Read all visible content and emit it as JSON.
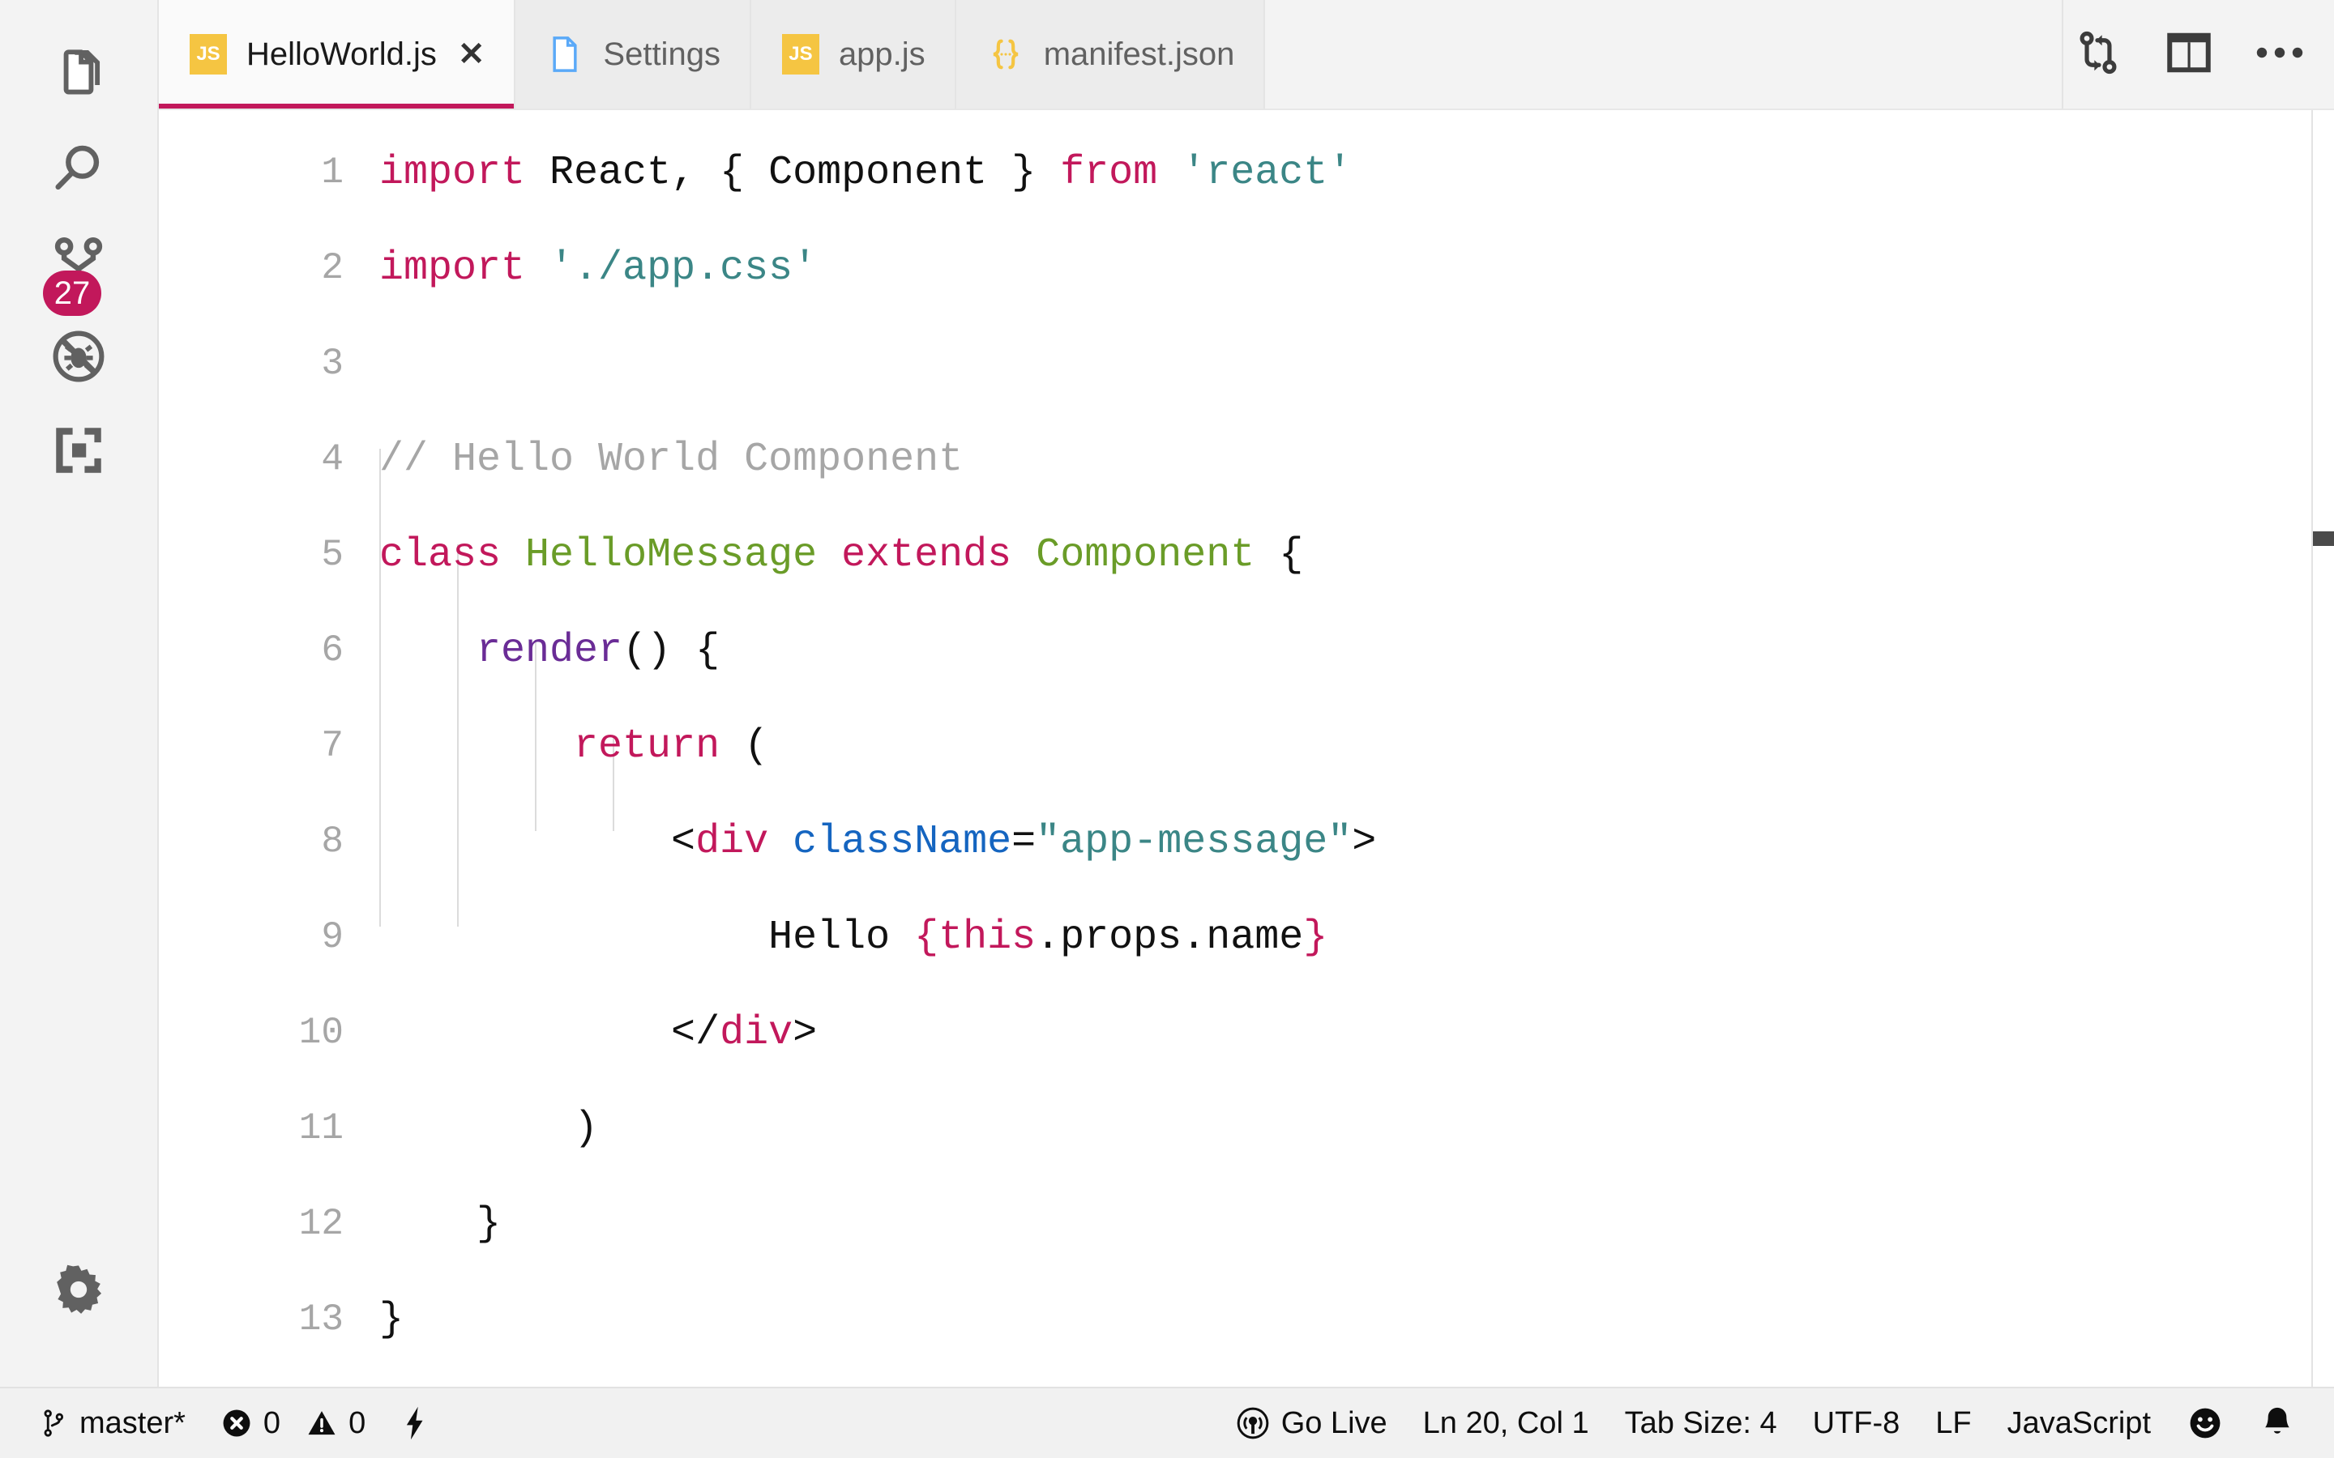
{
  "theme": {
    "accent": "#c2185b",
    "tabbar_bg": "#f3f3f3",
    "active_tab_bg": "#fafafa",
    "activity_bar_bg": "#f3f3f3",
    "editor_bg": "#ffffff",
    "statusbar_bg": "#f1f1f1",
    "line_number_color": "#a6a6a6",
    "keyword_color": "#c2185b",
    "string_color": "#3b8686",
    "comment_color": "#a6a6a6",
    "class_color": "#6a9c28",
    "function_color": "#6a2c96",
    "attribute_color": "#1565c0",
    "js_icon_color": "#f5c542",
    "json_icon_color": "#f5c542",
    "settings_icon_color": "#5aa9f8"
  },
  "activity_bar": {
    "items": [
      {
        "name": "explorer",
        "icon": "files-icon",
        "badge": null
      },
      {
        "name": "search",
        "icon": "search-icon",
        "badge": null
      },
      {
        "name": "source-control",
        "icon": "branch-icon",
        "badge": "27"
      },
      {
        "name": "run-and-debug",
        "icon": "debug-icon",
        "badge": null
      },
      {
        "name": "extensions",
        "icon": "extensions-icon",
        "badge": null
      }
    ],
    "bottom_items": [
      {
        "name": "manage-settings",
        "icon": "gear-icon"
      }
    ]
  },
  "tabbar": {
    "tabs": [
      {
        "label": "HelloWorld.js",
        "icon": "js-file-icon",
        "active": true,
        "close_label": "✕"
      },
      {
        "label": "Settings",
        "icon": "settings-file-icon",
        "active": false,
        "close_label": ""
      },
      {
        "label": "app.js",
        "icon": "js-file-icon",
        "active": false,
        "close_label": ""
      },
      {
        "label": "manifest.json",
        "icon": "json-file-icon",
        "active": false,
        "close_label": ""
      }
    ],
    "actions": [
      {
        "name": "open-changes-button",
        "icon": "git-compare-icon"
      },
      {
        "name": "split-editor-button",
        "icon": "split-editor-icon"
      },
      {
        "name": "more-actions-button",
        "icon": "more-actions-icon"
      }
    ]
  },
  "editor": {
    "language": "JavaScript",
    "file": "HelloWorld.js",
    "indent_size": 4,
    "lines": [
      {
        "number": "1",
        "tokens": [
          {
            "text": "import",
            "cls": "t-kw"
          },
          {
            "text": " React, { Component } ",
            "cls": "t-pln"
          },
          {
            "text": "from",
            "cls": "t-kw"
          },
          {
            "text": " ",
            "cls": "t-pln"
          },
          {
            "text": "'react'",
            "cls": "t-str"
          }
        ]
      },
      {
        "number": "2",
        "tokens": [
          {
            "text": "import",
            "cls": "t-kw"
          },
          {
            "text": " ",
            "cls": "t-pln"
          },
          {
            "text": "'./app.css'",
            "cls": "t-str"
          }
        ]
      },
      {
        "number": "3",
        "tokens": []
      },
      {
        "number": "4",
        "tokens": [
          {
            "text": "// Hello World Component",
            "cls": "t-cmt"
          }
        ]
      },
      {
        "number": "5",
        "tokens": [
          {
            "text": "class",
            "cls": "t-kw"
          },
          {
            "text": " ",
            "cls": "t-pln"
          },
          {
            "text": "HelloMessage",
            "cls": "t-cls"
          },
          {
            "text": " ",
            "cls": "t-pln"
          },
          {
            "text": "extends",
            "cls": "t-kw"
          },
          {
            "text": " ",
            "cls": "t-pln"
          },
          {
            "text": "Component",
            "cls": "t-cls"
          },
          {
            "text": " {",
            "cls": "t-pln"
          }
        ]
      },
      {
        "number": "6",
        "tokens": [
          {
            "text": "    ",
            "cls": "t-pln"
          },
          {
            "text": "render",
            "cls": "t-fn"
          },
          {
            "text": "() {",
            "cls": "t-pln"
          }
        ]
      },
      {
        "number": "7",
        "tokens": [
          {
            "text": "        ",
            "cls": "t-pln"
          },
          {
            "text": "return",
            "cls": "t-kw"
          },
          {
            "text": " (",
            "cls": "t-pln"
          }
        ]
      },
      {
        "number": "8",
        "tokens": [
          {
            "text": "            <",
            "cls": "t-pln"
          },
          {
            "text": "div",
            "cls": "t-kw"
          },
          {
            "text": " ",
            "cls": "t-pln"
          },
          {
            "text": "className",
            "cls": "t-attr"
          },
          {
            "text": "=",
            "cls": "t-pln"
          },
          {
            "text": "\"app-message\"",
            "cls": "t-str"
          },
          {
            "text": ">",
            "cls": "t-pln"
          }
        ]
      },
      {
        "number": "9",
        "tokens": [
          {
            "text": "                Hello ",
            "cls": "t-pln"
          },
          {
            "text": "{",
            "cls": "t-kw"
          },
          {
            "text": "this",
            "cls": "t-kw"
          },
          {
            "text": ".props.name",
            "cls": "t-pln"
          },
          {
            "text": "}",
            "cls": "t-kw"
          }
        ]
      },
      {
        "number": "10",
        "tokens": [
          {
            "text": "            </",
            "cls": "t-pln"
          },
          {
            "text": "div",
            "cls": "t-kw"
          },
          {
            "text": ">",
            "cls": "t-pln"
          }
        ]
      },
      {
        "number": "11",
        "tokens": [
          {
            "text": "        )",
            "cls": "t-pln"
          }
        ]
      },
      {
        "number": "12",
        "tokens": [
          {
            "text": "    }",
            "cls": "t-pln"
          }
        ]
      },
      {
        "number": "13",
        "tokens": [
          {
            "text": "}",
            "cls": "t-pln"
          }
        ]
      }
    ]
  },
  "statusbar": {
    "left": [
      {
        "name": "branch-status",
        "icon": "branch-icon",
        "label": "master*"
      },
      {
        "name": "problems-status",
        "icon": "error-icon",
        "label": "0",
        "icon2": "warning-icon",
        "label2": "0"
      },
      {
        "name": "live-share-status",
        "icon": "bolt-icon",
        "label": ""
      }
    ],
    "branch": "master*",
    "errors": "0",
    "warnings": "0",
    "go_live": "Go Live",
    "cursor_position": "Ln 20, Col 1",
    "tab_size": "Tab Size: 4",
    "encoding": "UTF-8",
    "eol": "LF",
    "language": "JavaScript",
    "feedback_icon": "smiley-icon",
    "notifications_icon": "bell-icon"
  }
}
